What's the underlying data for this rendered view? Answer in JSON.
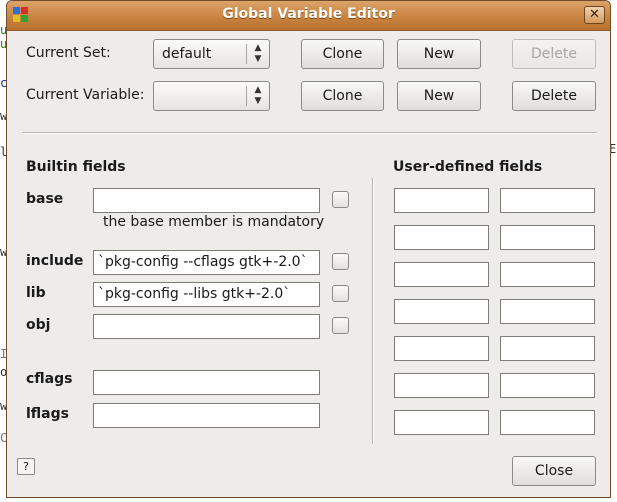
{
  "window": {
    "title": "Global Variable Editor",
    "close_glyph": "✕"
  },
  "background": {
    "fragments": [
      "u",
      "u",
      "c",
      "w",
      "l",
      "w",
      "E",
      "I",
      "o",
      "w",
      "C"
    ]
  },
  "row1": {
    "label": "Current Set:",
    "combo_value": "default",
    "clone": "Clone",
    "new": "New",
    "delete": "Delete"
  },
  "row2": {
    "label": "Current Variable:",
    "combo_value": "",
    "clone": "Clone",
    "new": "New",
    "delete": "Delete"
  },
  "builtin": {
    "heading": "Builtin fields",
    "base_label": "base",
    "base_value": "",
    "base_note": "the base member is mandatory",
    "include_label": "include",
    "include_value": "`pkg-config --cflags gtk+-2.0`",
    "lib_label": "lib",
    "lib_value": "`pkg-config --libs gtk+-2.0`",
    "obj_label": "obj",
    "obj_value": "",
    "cflags_label": "cflags",
    "cflags_value": "",
    "lflags_label": "lflags",
    "lflags_value": ""
  },
  "user": {
    "heading": "User-defined fields",
    "rows": [
      [
        "",
        ""
      ],
      [
        "",
        ""
      ],
      [
        "",
        ""
      ],
      [
        "",
        ""
      ],
      [
        "",
        ""
      ],
      [
        "",
        ""
      ],
      [
        "",
        ""
      ]
    ]
  },
  "footer": {
    "help": "?",
    "close": "Close"
  },
  "colors": {
    "titlebar": "#c98440",
    "window": "#edeceb",
    "bg_text_green": "#2e7d0a",
    "bg_text_blue": "#1a2a9a"
  }
}
